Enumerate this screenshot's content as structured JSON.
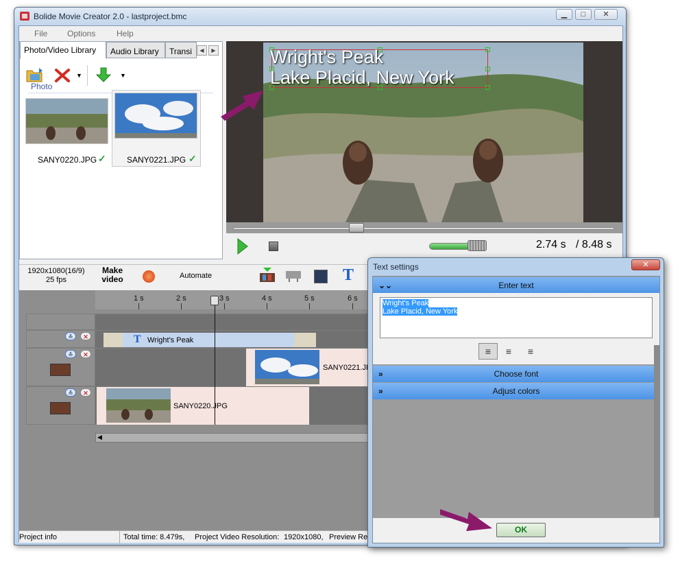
{
  "window": {
    "title": "Bolide Movie Creator 2.0 - lastproject.bmc",
    "minimize_label": "▁",
    "maximize_label": "□",
    "close_label": "✕"
  },
  "menu": [
    "File",
    "Options",
    "Help"
  ],
  "library": {
    "tabs": [
      "Photo/Video Library",
      "Audio Library",
      "Transi"
    ],
    "section": "Photo",
    "files": [
      "SANY0220.JPG",
      "SANY0221.JPG"
    ],
    "check": "✓"
  },
  "preview": {
    "overlay_line1": "Wright's Peak",
    "overlay_line2": "Lake Placid, New York",
    "current_time": "2.74 s",
    "total_time": "/ 8.48 s",
    "progress": 0.323,
    "volume": 0.72
  },
  "timeline_toolbar": {
    "resolution": "1920x1080(16/9)",
    "fps": "25 fps",
    "make_video": "Make video",
    "automate": "Automate"
  },
  "ruler": [
    "1 s",
    "2 s",
    "3 s",
    "4 s",
    "5 s",
    "6 s"
  ],
  "tracks": {
    "text_clip": "Wright's Peak",
    "video_clip_1": "SANY0221.JPG",
    "video_clip_2": "SANY0220.JPG"
  },
  "status": {
    "project_info": "Project info",
    "total_time": "Total time: 8.479s,",
    "project_res": "Project Video Resolution:",
    "res_value": "1920x1080,",
    "preview_res": "Preview Res"
  },
  "dialog": {
    "title": "Text settings",
    "close_label": "✕",
    "enter_text": "Enter text",
    "text_line1": "Wright's Peak",
    "text_line2": "Lake Placid, New York",
    "choose_font": "Choose font",
    "adjust_colors": "Adjust colors",
    "ok": "OK"
  },
  "colors": {
    "annotation_arrow": "#8b1a6b",
    "section_blue": "#5aa0ec",
    "ok_green": "#0b7a16",
    "text_frame": "#c8313a",
    "handle": "#2fbf2f"
  }
}
